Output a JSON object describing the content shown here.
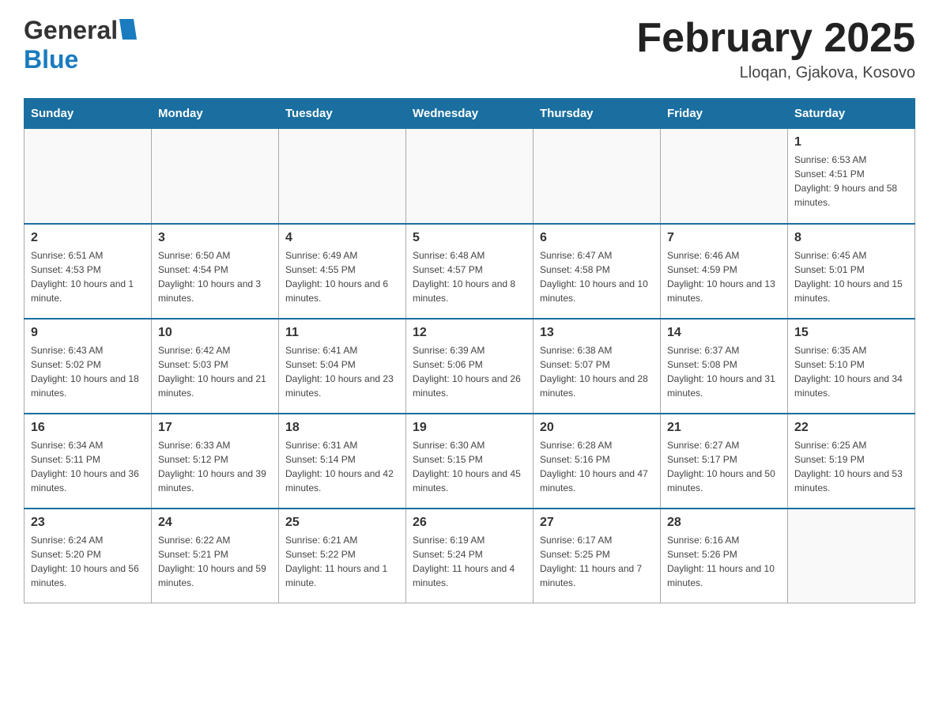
{
  "header": {
    "logo_general": "General",
    "logo_blue": "Blue",
    "month_title": "February 2025",
    "subtitle": "Lloqan, Gjakova, Kosovo"
  },
  "weekdays": [
    "Sunday",
    "Monday",
    "Tuesday",
    "Wednesday",
    "Thursday",
    "Friday",
    "Saturday"
  ],
  "weeks": [
    [
      {
        "day": "",
        "sunrise": "",
        "sunset": "",
        "daylight": ""
      },
      {
        "day": "",
        "sunrise": "",
        "sunset": "",
        "daylight": ""
      },
      {
        "day": "",
        "sunrise": "",
        "sunset": "",
        "daylight": ""
      },
      {
        "day": "",
        "sunrise": "",
        "sunset": "",
        "daylight": ""
      },
      {
        "day": "",
        "sunrise": "",
        "sunset": "",
        "daylight": ""
      },
      {
        "day": "",
        "sunrise": "",
        "sunset": "",
        "daylight": ""
      },
      {
        "day": "1",
        "sunrise": "Sunrise: 6:53 AM",
        "sunset": "Sunset: 4:51 PM",
        "daylight": "Daylight: 9 hours and 58 minutes."
      }
    ],
    [
      {
        "day": "2",
        "sunrise": "Sunrise: 6:51 AM",
        "sunset": "Sunset: 4:53 PM",
        "daylight": "Daylight: 10 hours and 1 minute."
      },
      {
        "day": "3",
        "sunrise": "Sunrise: 6:50 AM",
        "sunset": "Sunset: 4:54 PM",
        "daylight": "Daylight: 10 hours and 3 minutes."
      },
      {
        "day": "4",
        "sunrise": "Sunrise: 6:49 AM",
        "sunset": "Sunset: 4:55 PM",
        "daylight": "Daylight: 10 hours and 6 minutes."
      },
      {
        "day": "5",
        "sunrise": "Sunrise: 6:48 AM",
        "sunset": "Sunset: 4:57 PM",
        "daylight": "Daylight: 10 hours and 8 minutes."
      },
      {
        "day": "6",
        "sunrise": "Sunrise: 6:47 AM",
        "sunset": "Sunset: 4:58 PM",
        "daylight": "Daylight: 10 hours and 10 minutes."
      },
      {
        "day": "7",
        "sunrise": "Sunrise: 6:46 AM",
        "sunset": "Sunset: 4:59 PM",
        "daylight": "Daylight: 10 hours and 13 minutes."
      },
      {
        "day": "8",
        "sunrise": "Sunrise: 6:45 AM",
        "sunset": "Sunset: 5:01 PM",
        "daylight": "Daylight: 10 hours and 15 minutes."
      }
    ],
    [
      {
        "day": "9",
        "sunrise": "Sunrise: 6:43 AM",
        "sunset": "Sunset: 5:02 PM",
        "daylight": "Daylight: 10 hours and 18 minutes."
      },
      {
        "day": "10",
        "sunrise": "Sunrise: 6:42 AM",
        "sunset": "Sunset: 5:03 PM",
        "daylight": "Daylight: 10 hours and 21 minutes."
      },
      {
        "day": "11",
        "sunrise": "Sunrise: 6:41 AM",
        "sunset": "Sunset: 5:04 PM",
        "daylight": "Daylight: 10 hours and 23 minutes."
      },
      {
        "day": "12",
        "sunrise": "Sunrise: 6:39 AM",
        "sunset": "Sunset: 5:06 PM",
        "daylight": "Daylight: 10 hours and 26 minutes."
      },
      {
        "day": "13",
        "sunrise": "Sunrise: 6:38 AM",
        "sunset": "Sunset: 5:07 PM",
        "daylight": "Daylight: 10 hours and 28 minutes."
      },
      {
        "day": "14",
        "sunrise": "Sunrise: 6:37 AM",
        "sunset": "Sunset: 5:08 PM",
        "daylight": "Daylight: 10 hours and 31 minutes."
      },
      {
        "day": "15",
        "sunrise": "Sunrise: 6:35 AM",
        "sunset": "Sunset: 5:10 PM",
        "daylight": "Daylight: 10 hours and 34 minutes."
      }
    ],
    [
      {
        "day": "16",
        "sunrise": "Sunrise: 6:34 AM",
        "sunset": "Sunset: 5:11 PM",
        "daylight": "Daylight: 10 hours and 36 minutes."
      },
      {
        "day": "17",
        "sunrise": "Sunrise: 6:33 AM",
        "sunset": "Sunset: 5:12 PM",
        "daylight": "Daylight: 10 hours and 39 minutes."
      },
      {
        "day": "18",
        "sunrise": "Sunrise: 6:31 AM",
        "sunset": "Sunset: 5:14 PM",
        "daylight": "Daylight: 10 hours and 42 minutes."
      },
      {
        "day": "19",
        "sunrise": "Sunrise: 6:30 AM",
        "sunset": "Sunset: 5:15 PM",
        "daylight": "Daylight: 10 hours and 45 minutes."
      },
      {
        "day": "20",
        "sunrise": "Sunrise: 6:28 AM",
        "sunset": "Sunset: 5:16 PM",
        "daylight": "Daylight: 10 hours and 47 minutes."
      },
      {
        "day": "21",
        "sunrise": "Sunrise: 6:27 AM",
        "sunset": "Sunset: 5:17 PM",
        "daylight": "Daylight: 10 hours and 50 minutes."
      },
      {
        "day": "22",
        "sunrise": "Sunrise: 6:25 AM",
        "sunset": "Sunset: 5:19 PM",
        "daylight": "Daylight: 10 hours and 53 minutes."
      }
    ],
    [
      {
        "day": "23",
        "sunrise": "Sunrise: 6:24 AM",
        "sunset": "Sunset: 5:20 PM",
        "daylight": "Daylight: 10 hours and 56 minutes."
      },
      {
        "day": "24",
        "sunrise": "Sunrise: 6:22 AM",
        "sunset": "Sunset: 5:21 PM",
        "daylight": "Daylight: 10 hours and 59 minutes."
      },
      {
        "day": "25",
        "sunrise": "Sunrise: 6:21 AM",
        "sunset": "Sunset: 5:22 PM",
        "daylight": "Daylight: 11 hours and 1 minute."
      },
      {
        "day": "26",
        "sunrise": "Sunrise: 6:19 AM",
        "sunset": "Sunset: 5:24 PM",
        "daylight": "Daylight: 11 hours and 4 minutes."
      },
      {
        "day": "27",
        "sunrise": "Sunrise: 6:17 AM",
        "sunset": "Sunset: 5:25 PM",
        "daylight": "Daylight: 11 hours and 7 minutes."
      },
      {
        "day": "28",
        "sunrise": "Sunrise: 6:16 AM",
        "sunset": "Sunset: 5:26 PM",
        "daylight": "Daylight: 11 hours and 10 minutes."
      },
      {
        "day": "",
        "sunrise": "",
        "sunset": "",
        "daylight": ""
      }
    ]
  ]
}
